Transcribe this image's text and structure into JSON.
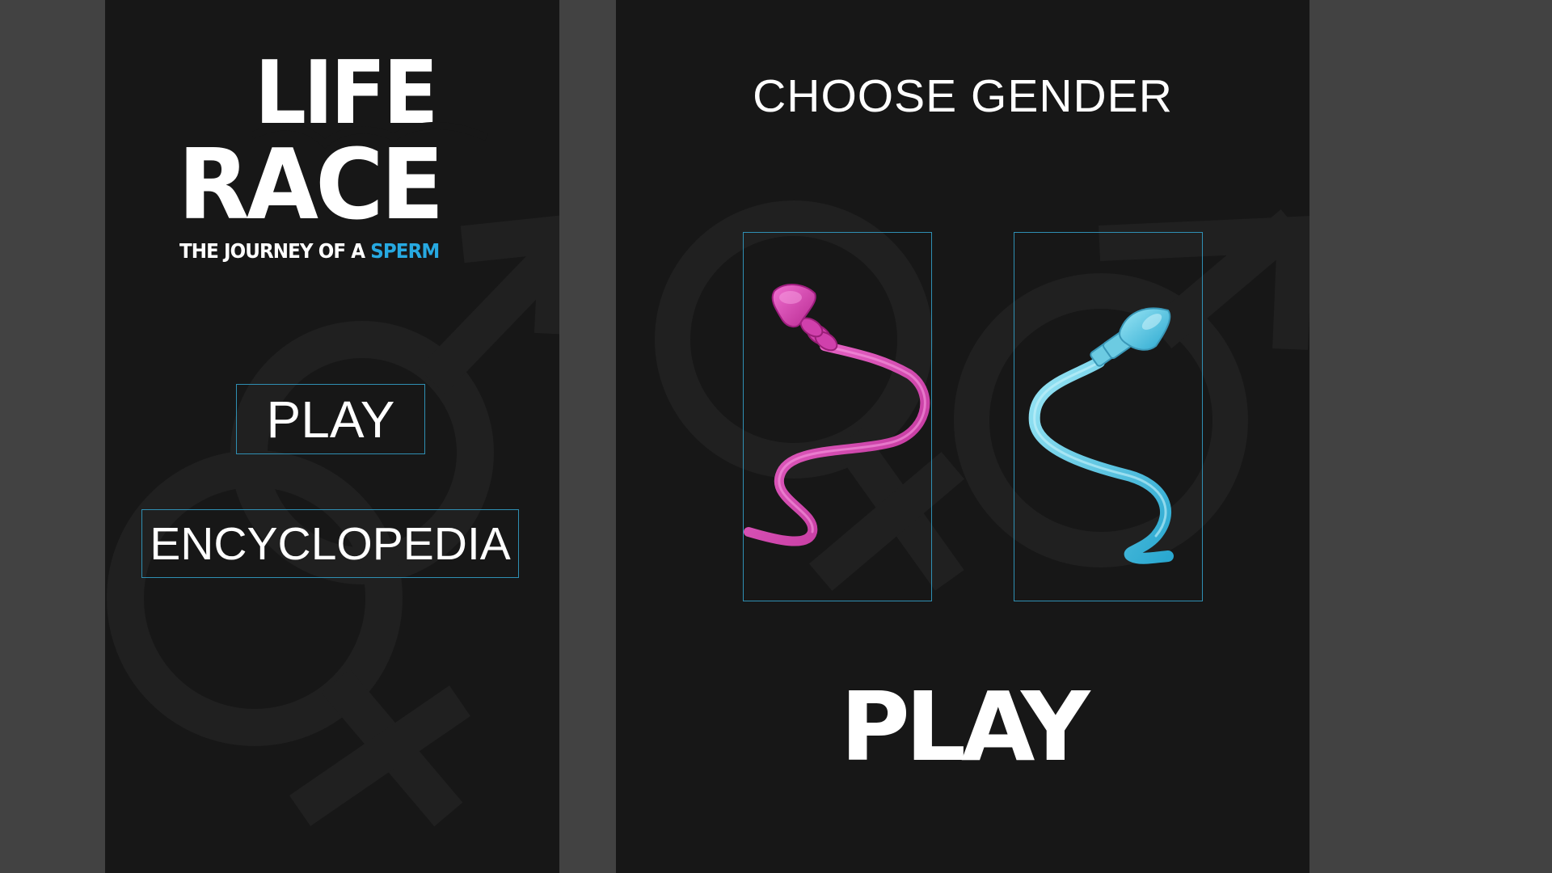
{
  "logo": {
    "line1": "LIFE",
    "line2": "RACE",
    "tagline_main": "THE JOURNEY OF A ",
    "tagline_accent": "SPERM"
  },
  "menu": {
    "play_label": "PLAY",
    "encyclopedia_label": "ENCYCLOPEDIA"
  },
  "gender_select": {
    "title": "CHOOSE GENDER",
    "options": [
      {
        "icon": "female-sperm-icon",
        "color": "#e040b8"
      },
      {
        "icon": "male-sperm-icon",
        "color": "#4cc8e8"
      }
    ],
    "play_label": "PLAY"
  },
  "colors": {
    "page_background": "#424242",
    "panel_background": "#171717",
    "button_border": "#2f8fb3",
    "accent": "#27a9e1",
    "text": "#ffffff"
  }
}
